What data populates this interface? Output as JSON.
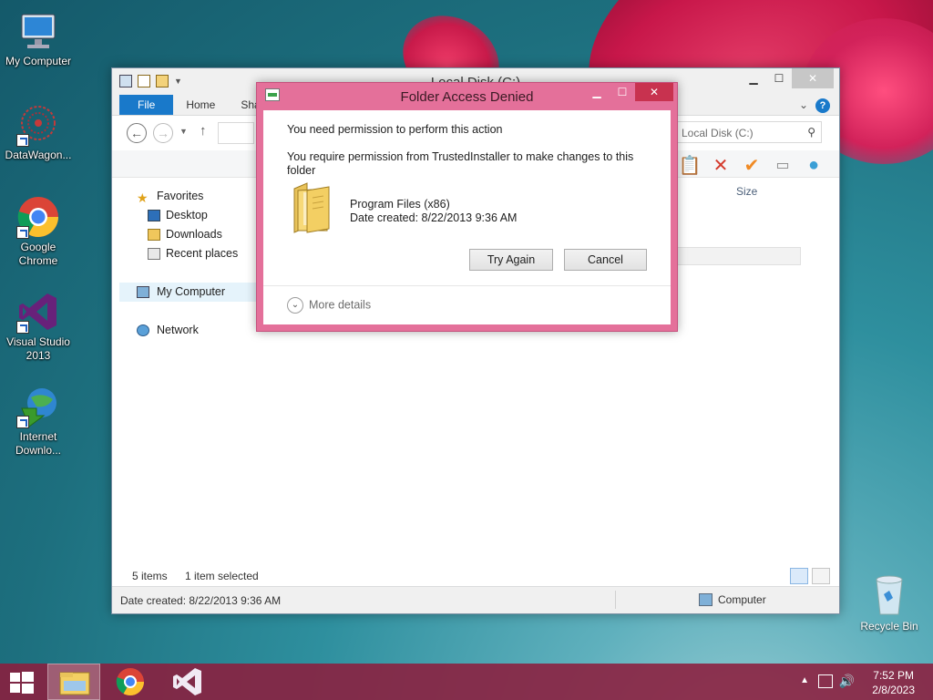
{
  "desktop": {
    "icons": [
      {
        "label": "My Computer"
      },
      {
        "label": "DataWagon..."
      },
      {
        "label": "Google Chrome"
      },
      {
        "label": "Visual Studio 2013"
      },
      {
        "label": "Internet Downlo..."
      }
    ],
    "recycle_bin": "Recycle Bin"
  },
  "explorer": {
    "title": "Local Disk (C:)",
    "tabs": [
      "File",
      "Home",
      "Shar"
    ],
    "search_placeholder": "Local Disk (C:)",
    "column_size": "Size",
    "nav": {
      "favorites": "Favorites",
      "desktop": "Desktop",
      "downloads": "Downloads",
      "recent": "Recent places",
      "my_computer": "My Computer",
      "network": "Network"
    },
    "status": {
      "items": "5 items",
      "selected": "1 item selected"
    },
    "details": {
      "date_created": "Date created: 8/22/2013 9:36 AM",
      "location": "Computer"
    }
  },
  "dialog": {
    "title": "Folder Access Denied",
    "heading": "You need permission to perform this action",
    "message": "You require permission from TrustedInstaller to make changes to this folder",
    "folder_name": "Program Files (x86)",
    "folder_date": "Date created: 8/22/2013 9:36 AM",
    "try_again": "Try Again",
    "cancel": "Cancel",
    "more_details": "More details",
    "accent_color": "#e4709a"
  },
  "taskbar": {
    "time": "7:52 PM",
    "date": "2/8/2023",
    "color": "#8c1e3e"
  }
}
